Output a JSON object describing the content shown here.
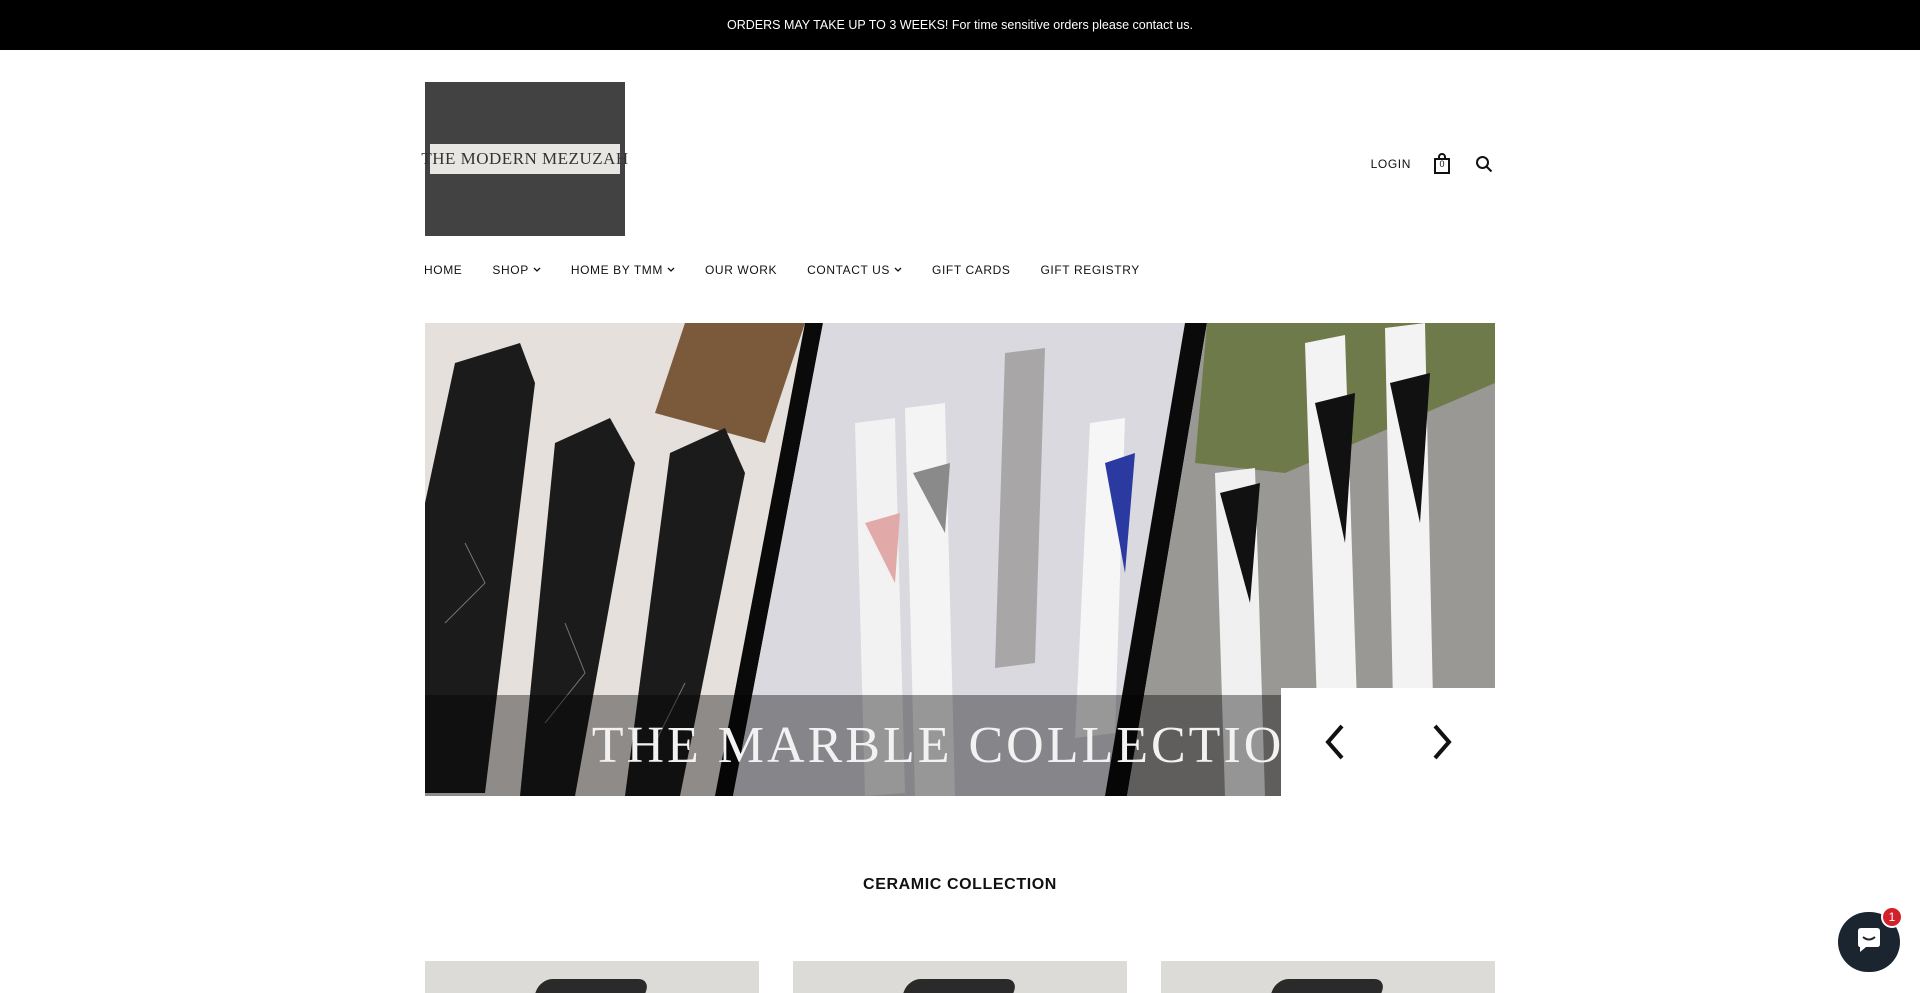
{
  "announcement": {
    "text": "ORDERS MAY TAKE UP TO 3 WEEKS! For time sensitive orders please contact us."
  },
  "logo": {
    "text": "THE MODERN MEZUZAH"
  },
  "header": {
    "login_label": "LOGIN",
    "cart_count": "0",
    "cart_icon": "bag-icon",
    "search_icon": "search-icon"
  },
  "nav": {
    "items": [
      {
        "label": "HOME",
        "has_dropdown": false
      },
      {
        "label": "SHOP",
        "has_dropdown": true
      },
      {
        "label": "HOME BY TMM",
        "has_dropdown": true
      },
      {
        "label": "OUR WORK",
        "has_dropdown": false
      },
      {
        "label": "CONTACT US",
        "has_dropdown": true
      },
      {
        "label": "GIFT CARDS",
        "has_dropdown": false
      },
      {
        "label": "GIFT REGISTRY",
        "has_dropdown": false
      }
    ]
  },
  "hero": {
    "caption": "THE MARBLE COLLECTIO",
    "prev_icon": "chevron-left-icon",
    "next_icon": "chevron-right-icon"
  },
  "section": {
    "title": "CERAMIC COLLECTION"
  },
  "chat": {
    "icon": "chat-bubble-icon",
    "badge_count": "1"
  },
  "colors": {
    "announcement_bg": "#000000",
    "logo_bg": "#424242",
    "chat_bg": "#1a2530",
    "badge_bg": "#d3212c"
  }
}
